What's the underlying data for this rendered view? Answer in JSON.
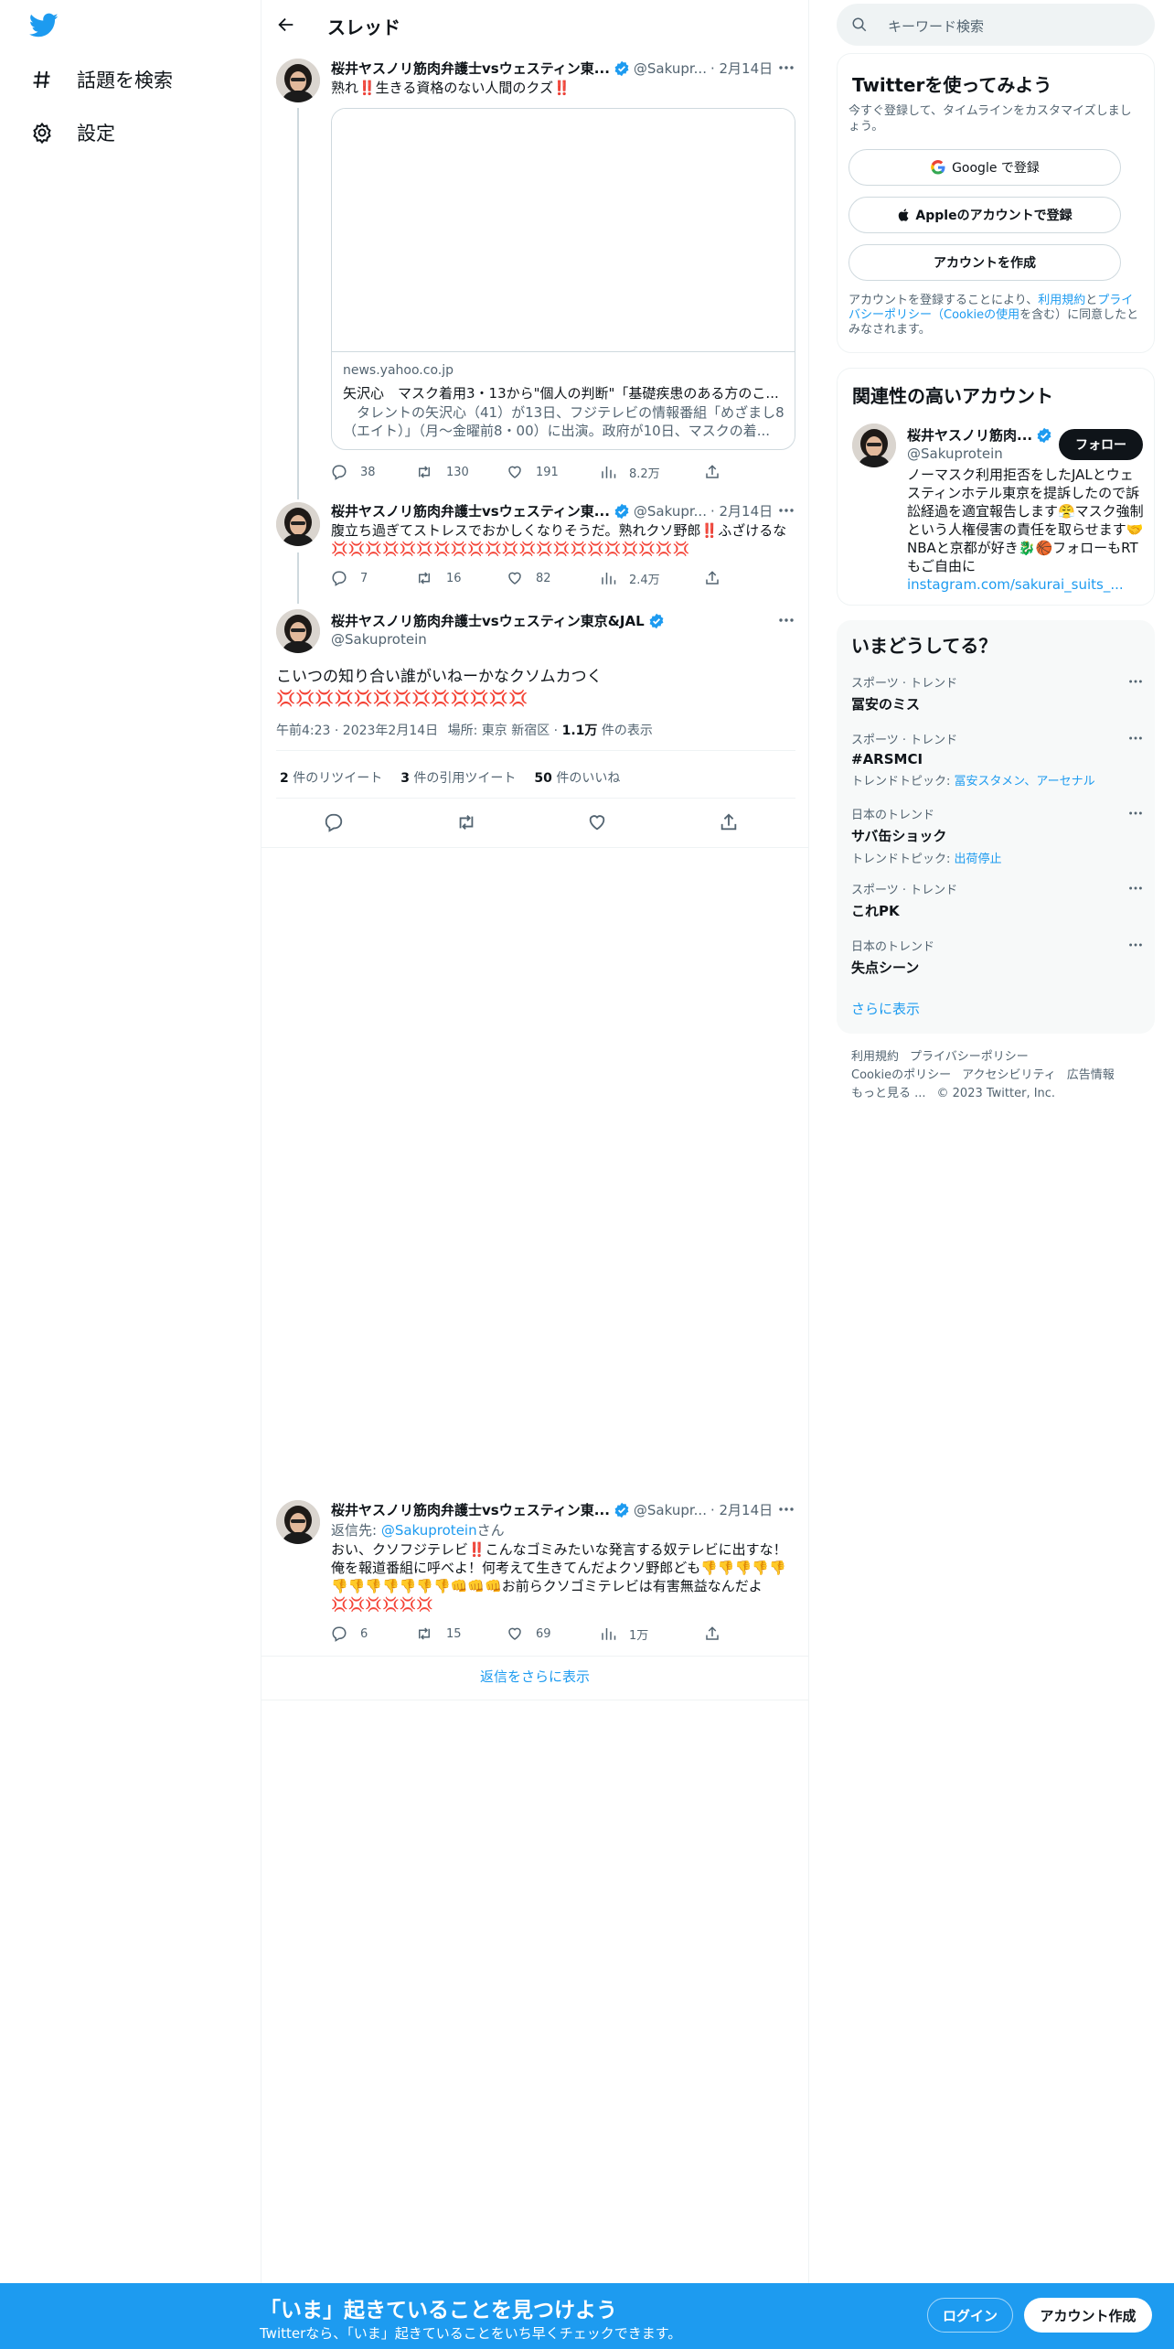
{
  "nav": {
    "items": [
      {
        "label": "話題を検索",
        "icon": "hashtag-icon"
      },
      {
        "label": "設定",
        "icon": "gear-icon"
      }
    ]
  },
  "header": {
    "title": "スレッド"
  },
  "author": {
    "name_short": "桜井ヤスノリ筋肉弁護士vsウェスティン東...",
    "name_full": "桜井ヤスノリ筋肉弁護士vsウェスティン東京&JAL",
    "handle_short": "@Sakupr...",
    "handle_full": "@Sakuprotein"
  },
  "tweets": [
    {
      "date": "· 2月14日",
      "text": "熟れ‼️生きる資格のない人間のクズ‼️",
      "card": {
        "domain": "news.yahoo.co.jp",
        "title": "矢沢心　マスク着用3・13から\"個人の判断\"「基礎疾患のある方のこ...",
        "desc": "　タレントの矢沢心（41）が13日、フジテレビの情報番組「めざまし8（エイト）」（月～金曜前8・00）に出演。政府が10日、マスクの着..."
      },
      "stats": {
        "replies": "38",
        "retweets": "130",
        "likes": "191",
        "views": "8.2万"
      }
    },
    {
      "date": "· 2月14日",
      "text": "腹立ち過ぎてストレスでおかしくなりそうだ。熟れクソ野郎‼️ふざけるな💢💢💢💢💢💢💢💢💢💢💢💢💢💢💢💢💢💢💢💢💢",
      "stats": {
        "replies": "7",
        "retweets": "16",
        "likes": "82",
        "views": "2.4万"
      }
    }
  ],
  "main_tweet": {
    "text": "こいつの知り合い誰がいねーかなクソムカつく💢💢💢💢💢💢💢💢💢💢💢💢💢",
    "meta_time": "午前4:23 · 2023年2月14日",
    "meta_place": "場所: 東京 新宿区",
    "meta_views_num": "1.1万",
    "meta_views_label": "件の表示",
    "stats": [
      {
        "num": "2",
        "label": "件のリツイート"
      },
      {
        "num": "3",
        "label": "件の引用ツイート"
      },
      {
        "num": "50",
        "label": "件のいいね"
      }
    ]
  },
  "reply": {
    "date": "· 2月14日",
    "reply_to_label": "返信先: ",
    "reply_to_handle": "@Sakuprotein",
    "reply_to_suffix": "さん",
    "text": "おい、クソフジテレビ‼️こんなゴミみたいな発言する奴テレビに出すな！俺を報道番組に呼べよ！何考えて生きてんだよクソ野郎ども👎👎👎👎👎👎👎👎👎👎👎👎👊👊👊お前らクソゴミテレビは有害無益なんだよ💢💢💢💢💢💢",
    "stats": {
      "replies": "6",
      "retweets": "15",
      "likes": "69",
      "views": "1万"
    }
  },
  "show_more_replies": "返信をさらに表示",
  "search": {
    "placeholder": "キーワード検索"
  },
  "signup": {
    "title": "Twitterを使ってみよう",
    "subtitle": "今すぐ登録して、タイムラインをカスタマイズしましょう。",
    "google_label": "Google で登録",
    "apple_label": "Appleのアカウントで登録",
    "create_label": "アカウントを作成",
    "terms_1": "アカウントを登録することにより、",
    "terms_link1": "利用規約",
    "terms_2": "と",
    "terms_link2": "プライバシーポリシー（Cookieの使用",
    "terms_3": "を含む）に同意したとみなされます。"
  },
  "related": {
    "title": "関連性の高いアカウント",
    "name": "桜井ヤスノリ筋肉...",
    "handle": "@Sakuprotein",
    "follow_label": "フォロー",
    "bio": "ノーマスク利用拒否をしたJALとウェスティンホテル東京を提訴したので訴訟経過を適宜報告します😤マスク強制という人権侵害の責任を取らせます🤝NBAと京都が好き🐉🏀フォローもRTもご自由に",
    "bio_link": "instagram.com/sakurai_suits_..."
  },
  "trends": {
    "title": "いまどうしてる？",
    "items": [
      {
        "category": "スポーツ · トレンド",
        "name": "冨安のミス"
      },
      {
        "category": "スポーツ · トレンド",
        "name": "#ARSMCI",
        "topic_label": "トレンドトピック: ",
        "topic": "冨安スタメン、アーセナル"
      },
      {
        "category": "日本のトレンド",
        "name": "サバ缶ショック",
        "topic_label": "トレンドトピック: ",
        "topic": "出荷停止"
      },
      {
        "category": "スポーツ · トレンド",
        "name": "これPK"
      },
      {
        "category": "日本のトレンド",
        "name": "失点シーン"
      }
    ],
    "show_more": "さらに表示"
  },
  "footer": {
    "links": [
      "利用規約",
      "プライバシーポリシー",
      "Cookieのポリシー",
      "アクセシビリティ",
      "広告情報",
      "もっと見る ..."
    ],
    "copyright": "© 2023 Twitter, Inc."
  },
  "bottom_bar": {
    "title": "「いま」起きていることを見つけよう",
    "subtitle": "Twitterなら、「いま」起きていることをいち早くチェックできます。",
    "login_label": "ログイン",
    "signup_label": "アカウント作成"
  },
  "colors": {
    "accent": "#1d9bf0",
    "text": "#0f1419",
    "muted": "#536471",
    "border": "#eff3f4"
  }
}
